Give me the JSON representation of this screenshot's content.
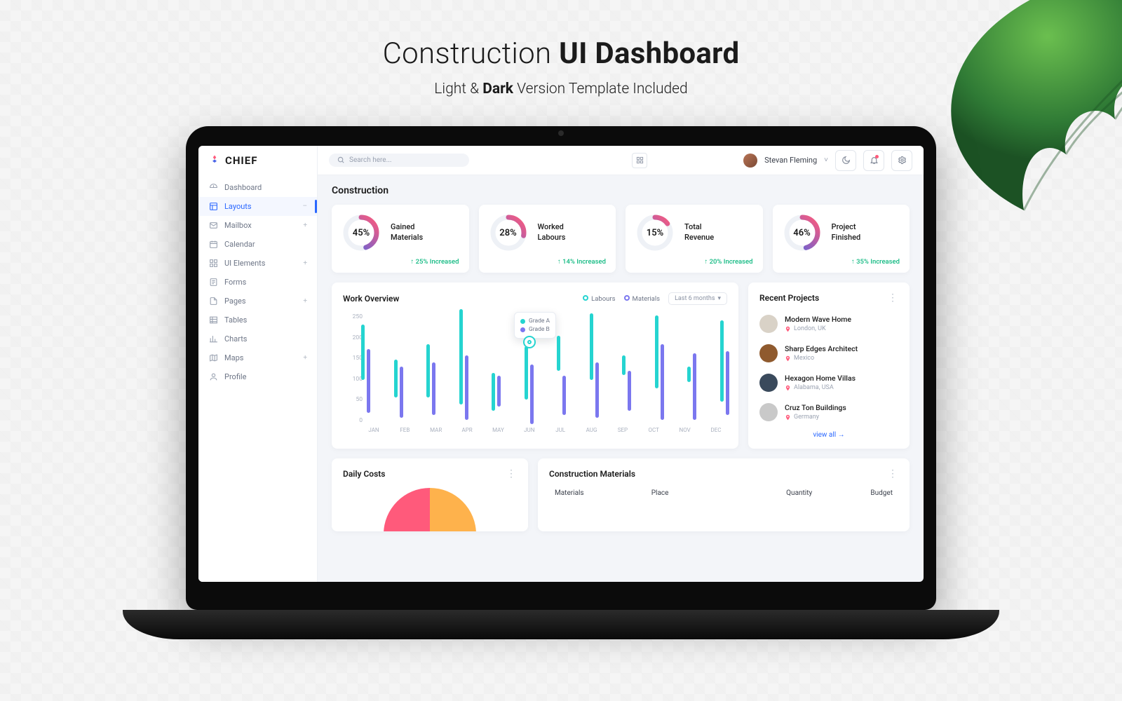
{
  "promo": {
    "title_light": "Construction",
    "title_bold": "UI Dashboard",
    "subtitle_pre": "Light & ",
    "subtitle_bold": "Dark",
    "subtitle_post": " Version Template Included"
  },
  "brand": "CHIEF",
  "sidebar": {
    "items": [
      {
        "icon": "dashboard",
        "label": "Dashboard",
        "expandable": false,
        "active": false
      },
      {
        "icon": "layouts",
        "label": "Layouts",
        "expandable": true,
        "active": true,
        "exp_symbol": "–"
      },
      {
        "icon": "mailbox",
        "label": "Mailbox",
        "expandable": true,
        "active": false,
        "exp_symbol": "+"
      },
      {
        "icon": "calendar",
        "label": "Calendar",
        "expandable": false,
        "active": false
      },
      {
        "icon": "ui",
        "label": "UI Elements",
        "expandable": true,
        "active": false,
        "exp_symbol": "+"
      },
      {
        "icon": "forms",
        "label": "Forms",
        "expandable": false,
        "active": false
      },
      {
        "icon": "pages",
        "label": "Pages",
        "expandable": true,
        "active": false,
        "exp_symbol": "+"
      },
      {
        "icon": "tables",
        "label": "Tables",
        "expandable": false,
        "active": false
      },
      {
        "icon": "charts",
        "label": "Charts",
        "expandable": false,
        "active": false
      },
      {
        "icon": "maps",
        "label": "Maps",
        "expandable": true,
        "active": false,
        "exp_symbol": "+"
      },
      {
        "icon": "profile",
        "label": "Profile",
        "expandable": false,
        "active": false
      }
    ]
  },
  "topbar": {
    "search_placeholder": "Search here...",
    "user_name": "Stevan Fleming",
    "chevron": "˅"
  },
  "page_title": "Construction",
  "stats": [
    {
      "pct": 45,
      "label1": "Gained",
      "label2": "Materials",
      "delta": "25% Increased"
    },
    {
      "pct": 28,
      "label1": "Worked",
      "label2": "Labours",
      "delta": "14% Increased"
    },
    {
      "pct": 15,
      "label1": "Total",
      "label2": "Revenue",
      "delta": "20% Increased"
    },
    {
      "pct": 46,
      "label1": "Project",
      "label2": "Finished",
      "delta": "35% Increased"
    }
  ],
  "work_overview": {
    "title": "Work Overview",
    "legend_a": "Labours",
    "legend_b": "Materials",
    "range_label": "Last 6 months",
    "tooltip_a": "Grade A",
    "tooltip_b": "Grade B"
  },
  "chart_data": {
    "type": "bar",
    "title": "Work Overview",
    "xlabel": "",
    "ylabel": "",
    "ylim": [
      0,
      250
    ],
    "y_ticks": [
      250,
      200,
      150,
      100,
      50,
      0
    ],
    "categories": [
      "JAN",
      "FEB",
      "MAR",
      "APR",
      "MAY",
      "JUN",
      "JUL",
      "AUG",
      "SEP",
      "OCT",
      "NOV",
      "DEC"
    ],
    "series": [
      {
        "name": "Labours",
        "color": "#25d4d0",
        "low": [
          100,
          60,
          60,
          45,
          30,
          55,
          120,
          100,
          110,
          80,
          95,
          50
        ],
        "high": [
          225,
          145,
          180,
          260,
          115,
          175,
          200,
          250,
          155,
          245,
          130,
          235
        ]
      },
      {
        "name": "Materials",
        "color": "#7b77ef",
        "low": [
          25,
          15,
          20,
          10,
          40,
          0,
          20,
          15,
          30,
          10,
          10,
          20
        ],
        "high": [
          170,
          130,
          140,
          155,
          110,
          135,
          110,
          140,
          120,
          180,
          160,
          165
        ]
      }
    ]
  },
  "recent_projects": {
    "title": "Recent Projects",
    "items": [
      {
        "name": "Modern Wave Home",
        "location": "London, UK",
        "avatar": "#d9d2c7"
      },
      {
        "name": "Sharp Edges Architect",
        "location": "Mexico",
        "avatar": "#8f5a2e"
      },
      {
        "name": "Hexagon Home Villas",
        "location": "Alabama, USA",
        "avatar": "#3a4a5c"
      },
      {
        "name": "Cruz Ton Buildings",
        "location": "Germany",
        "avatar": "#c9c9c9"
      }
    ],
    "view_all": "view all →"
  },
  "daily_costs": {
    "title": "Daily Costs"
  },
  "materials": {
    "title": "Construction Materials",
    "columns": [
      "Materials",
      "Place",
      "Quantity",
      "Budget"
    ]
  },
  "colors": {
    "teal": "#25d4d0",
    "violet": "#7b77ef",
    "grad_start": "#4a63e7",
    "grad_end": "#ff5a7b",
    "green": "#10b981",
    "pie_a": "#ff5a7b",
    "pie_b": "#feb24c"
  }
}
